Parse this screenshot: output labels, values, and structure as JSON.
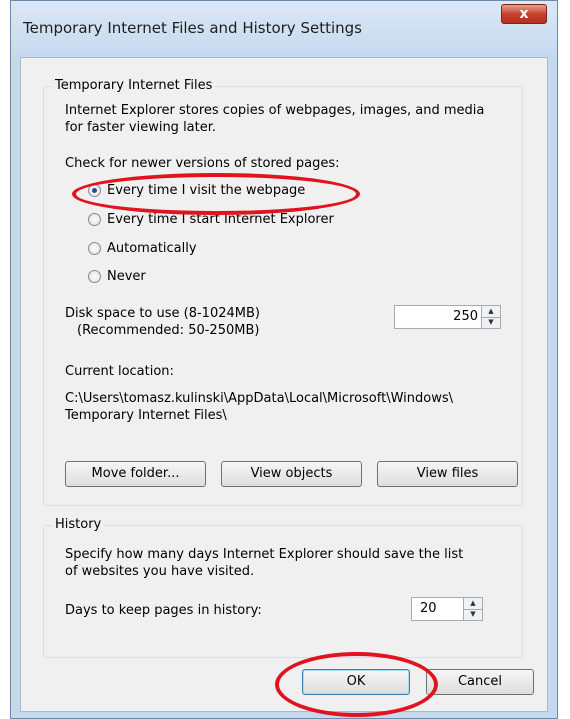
{
  "window": {
    "title": "Temporary Internet Files and History Settings",
    "close_label": "x"
  },
  "tif_group": {
    "legend": "Temporary Internet Files",
    "description_line1": "Internet Explorer stores copies of webpages, images, and media",
    "description_line2": "for faster viewing later.",
    "check_label": "Check for newer versions of stored pages:",
    "options": [
      {
        "label": "Every time I visit the webpage",
        "selected": true
      },
      {
        "label": "Every time I start Internet Explorer",
        "selected": false
      },
      {
        "label": "Automatically",
        "selected": false
      },
      {
        "label": "Never",
        "selected": false
      }
    ],
    "disk_space_label": "Disk space to use (8-1024MB)",
    "disk_space_recommended": "(Recommended: 50-250MB)",
    "disk_space_value": "250",
    "current_location_label": "Current location:",
    "location_line1": "C:\\Users\\tomasz.kulinski\\AppData\\Local\\Microsoft\\Windows\\",
    "location_line2": "Temporary Internet Files\\",
    "buttons": {
      "move_folder": "Move folder...",
      "view_objects": "View objects",
      "view_files": "View files"
    }
  },
  "history_group": {
    "legend": "History",
    "description_line1": "Specify how many days Internet Explorer should save the list",
    "description_line2": "of websites you have visited.",
    "days_label": "Days to keep pages in history:",
    "days_value": "20"
  },
  "footer": {
    "ok_label": "OK",
    "cancel_label": "Cancel"
  },
  "colors": {
    "annotation": "#e0141e",
    "window_frame": "#c4d8ee",
    "client_bg": "#f0f0f0"
  }
}
